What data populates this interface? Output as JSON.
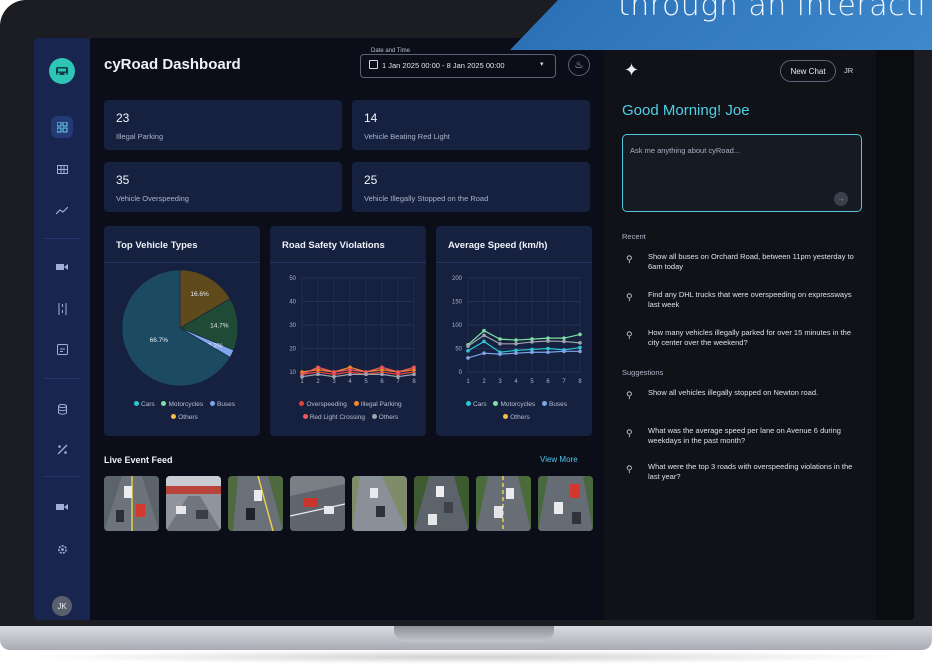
{
  "banner": {
    "text": "through an interacti"
  },
  "app": {
    "title": "cyRoad Dashboard"
  },
  "date_filter": {
    "label": "Date and Time",
    "value": "1 Jan 2025 00:00 - 8 Jan 2025 00:00"
  },
  "stats": [
    {
      "value": "23",
      "label": "Illegal Parking"
    },
    {
      "value": "14",
      "label": "Vehicle Beating Red Light"
    },
    {
      "value": "35",
      "label": "Vehicle Overspeeding"
    },
    {
      "value": "25",
      "label": "Vehicle Illegally Stopped on the Road"
    }
  ],
  "colors": {
    "cars": "#2ec5d6",
    "motorcycles": "#7fe0a4",
    "buses": "#7fa6ea",
    "others": "#f5c04a",
    "overspeeding": "#e2413b",
    "illegal_parking": "#f08a2b",
    "red_light": "#f0585a",
    "others_gray": "#a0a4ae"
  },
  "chart_data": [
    {
      "type": "pie",
      "title": "Top Vehicle Types",
      "categories": [
        "Cars",
        "Motorcycles",
        "Buses",
        "Others"
      ],
      "values": [
        66.7,
        14.7,
        2.2,
        16.6
      ],
      "labels": [
        "66.7%",
        "14.7%",
        "2.2%",
        "16.6%"
      ]
    },
    {
      "type": "line",
      "title": "Road Safety Violations",
      "x": [
        1,
        2,
        3,
        4,
        5,
        6,
        7,
        8
      ],
      "x_ticks": [
        "1",
        "2",
        "3",
        "4",
        "5",
        "6",
        "7",
        "8"
      ],
      "ylim": [
        10,
        50
      ],
      "y_ticks": [
        "10",
        "20",
        "30",
        "40",
        "50"
      ],
      "grid": true,
      "series": [
        {
          "name": "Overspeeding",
          "values": [
            9,
            10,
            9,
            10,
            9,
            10,
            9,
            10
          ]
        },
        {
          "name": "Illegal Parking",
          "values": [
            10,
            11,
            10,
            12,
            10,
            11,
            10,
            11
          ]
        },
        {
          "name": "Red Light Crossing",
          "values": [
            9,
            12,
            10,
            11,
            10,
            12,
            10,
            12
          ]
        },
        {
          "name": "Others",
          "values": [
            8,
            9,
            8,
            9,
            9,
            9,
            8,
            9
          ]
        }
      ]
    },
    {
      "type": "line",
      "title": "Average Speed (km/h)",
      "x": [
        1,
        2,
        3,
        4,
        5,
        6,
        7,
        8
      ],
      "x_ticks": [
        "1",
        "2",
        "3",
        "4",
        "5",
        "6",
        "7",
        "8"
      ],
      "ylim": [
        0,
        200
      ],
      "y_ticks": [
        "0",
        "50",
        "100",
        "150",
        "200"
      ],
      "grid": true,
      "series": [
        {
          "name": "Cars",
          "values": [
            45,
            65,
            42,
            46,
            48,
            50,
            47,
            52
          ]
        },
        {
          "name": "Motorcycles",
          "values": [
            58,
            88,
            70,
            68,
            70,
            72,
            72,
            80
          ]
        },
        {
          "name": "Buses",
          "values": [
            30,
            40,
            38,
            40,
            42,
            42,
            44,
            44
          ]
        },
        {
          "name": "Others",
          "values": [
            55,
            78,
            60,
            60,
            64,
            66,
            65,
            62
          ]
        }
      ]
    }
  ],
  "legends": {
    "vehicle_types": [
      "Cars",
      "Motorcycles",
      "Buses",
      "Others"
    ],
    "violations": [
      "Overspeeding",
      "Illegal Parking",
      "Red Light Crossing",
      "Others"
    ],
    "speed": [
      "Cars",
      "Motorcycles",
      "Buses",
      "Others"
    ]
  },
  "feed": {
    "title": "Live Event Feed",
    "view_more": "View More"
  },
  "chat": {
    "new_chat": "New Chat",
    "user_initials": "JR",
    "greeting": "Good Morning! Joe",
    "placeholder": "Ask me anything about cyRoad...",
    "recent_title": "Recent",
    "recent": [
      "Show all buses on Orchard Road, between 11pm yesterday to 6am today",
      "Find any DHL trucks that were overspeeding on expressways last week",
      "How many vehicles illegally parked for over 15 minutes in the city center over the weekend?"
    ],
    "suggestions_title": "Suggestions",
    "suggestions": [
      "Show all vehicles illegally stopped on Newton road.",
      "What was the average speed per lane on Avenue 6 during weekdays in the past month?",
      "What were the top 3 roads with overspeeding violations in the last year?"
    ]
  },
  "sidebar": {
    "avatar_initials": "JK"
  }
}
